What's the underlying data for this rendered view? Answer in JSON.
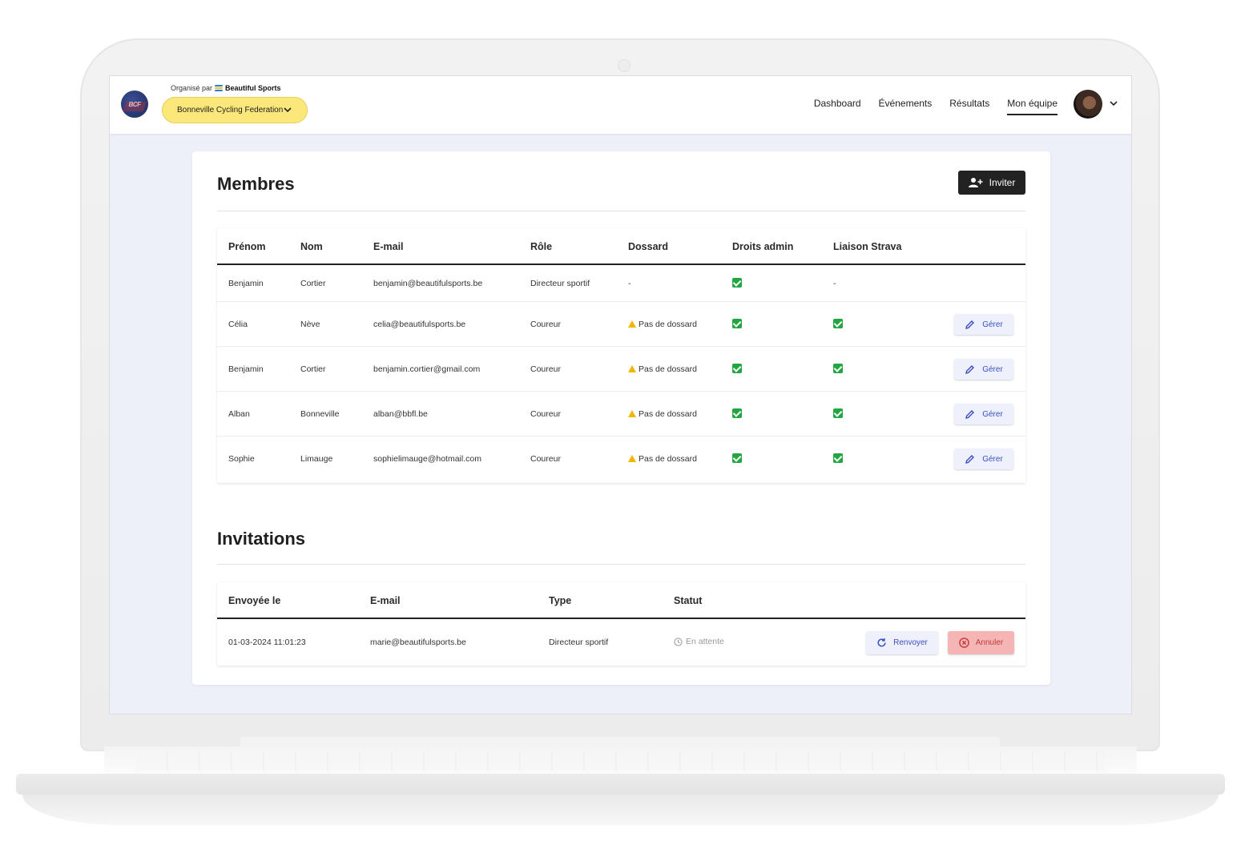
{
  "header": {
    "organizer_prefix": "Organisé par",
    "organizer_name": "Beautiful Sports",
    "logo_text": "BCF",
    "federation": "Bonneville Cycling Federation",
    "nav": [
      {
        "label": "Dashboard",
        "active": false
      },
      {
        "label": "Événements",
        "active": false
      },
      {
        "label": "Résultats",
        "active": false
      },
      {
        "label": "Mon équipe",
        "active": true
      }
    ]
  },
  "members": {
    "title": "Membres",
    "invite_label": "Inviter",
    "columns": [
      "Prénom",
      "Nom",
      "E-mail",
      "Rôle",
      "Dossard",
      "Droits admin",
      "Liaison Strava"
    ],
    "manage_label": "Gérer",
    "rows": [
      {
        "first": "Benjamin",
        "last": "Cortier",
        "email": "benjamin@beautifulsports.be",
        "role": "Directeur sportif",
        "bib": "-",
        "admin": true,
        "strava": "-"
      },
      {
        "first": "Célia",
        "last": "Nève",
        "email": "celia@beautifulsports.be",
        "role": "Coureur",
        "bib": "Pas de dossard",
        "admin": true,
        "strava": true
      },
      {
        "first": "Benjamin",
        "last": "Cortier",
        "email": "benjamin.cortier@gmail.com",
        "role": "Coureur",
        "bib": "Pas de dossard",
        "admin": true,
        "strava": true
      },
      {
        "first": "Alban",
        "last": "Bonneville",
        "email": "alban@bbfl.be",
        "role": "Coureur",
        "bib": "Pas de dossard",
        "admin": true,
        "strava": true
      },
      {
        "first": "Sophie",
        "last": "Limauge",
        "email": "sophielimauge@hotmail.com",
        "role": "Coureur",
        "bib": "Pas de dossard",
        "admin": true,
        "strava": true
      }
    ]
  },
  "invitations": {
    "title": "Invitations",
    "columns": [
      "Envoyée le",
      "E-mail",
      "Type",
      "Statut"
    ],
    "resend_label": "Renvoyer",
    "cancel_label": "Annuler",
    "rows": [
      {
        "sent": "01-03-2024 11:01:23",
        "email": "marie@beautifulsports.be",
        "type": "Directeur sportif",
        "status": "En attente"
      }
    ]
  },
  "colors": {
    "federation_pill": "#fbe77a",
    "check_green": "#22a641",
    "warning": "#f2b705",
    "link_blue": "#3b4fc0",
    "cancel_red": "#f5b5b5",
    "page_bg": "#eef0f9"
  },
  "icons": {
    "invite": "add-user-icon",
    "manage": "pencil-icon",
    "resend": "refresh-icon",
    "cancel": "cancel-circle-icon",
    "status": "clock-icon",
    "bib_warning": "warning-icon",
    "check": "check-icon"
  }
}
